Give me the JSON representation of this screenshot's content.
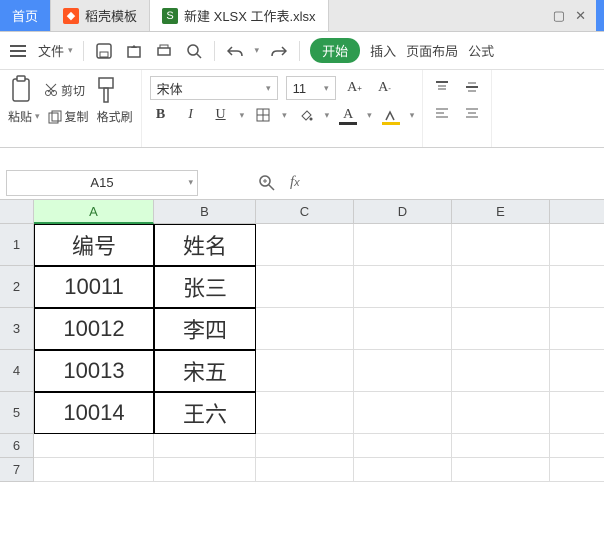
{
  "tabs": {
    "home": "首页",
    "template": "稻壳模板",
    "workbook": "新建 XLSX 工作表.xlsx"
  },
  "menu": {
    "file": "文件",
    "start": "开始",
    "insert": "插入",
    "layout": "页面布局",
    "formula": "公式"
  },
  "toolbar": {
    "paste": "粘贴",
    "cut": "剪切",
    "copy": "复制",
    "format_painter": "格式刷",
    "font_name": "宋体",
    "font_size": "11"
  },
  "namebox": "A15",
  "columns": [
    "A",
    "B",
    "C",
    "D",
    "E"
  ],
  "rows": [
    "1",
    "2",
    "3",
    "4",
    "5",
    "6",
    "7"
  ],
  "cells": {
    "A1": "编号",
    "B1": "姓名",
    "A2": "10011",
    "B2": "张三",
    "A3": "10012",
    "B3": "李四",
    "A4": "10013",
    "B4": "宋五",
    "A5": "10014",
    "B5": "王六"
  }
}
